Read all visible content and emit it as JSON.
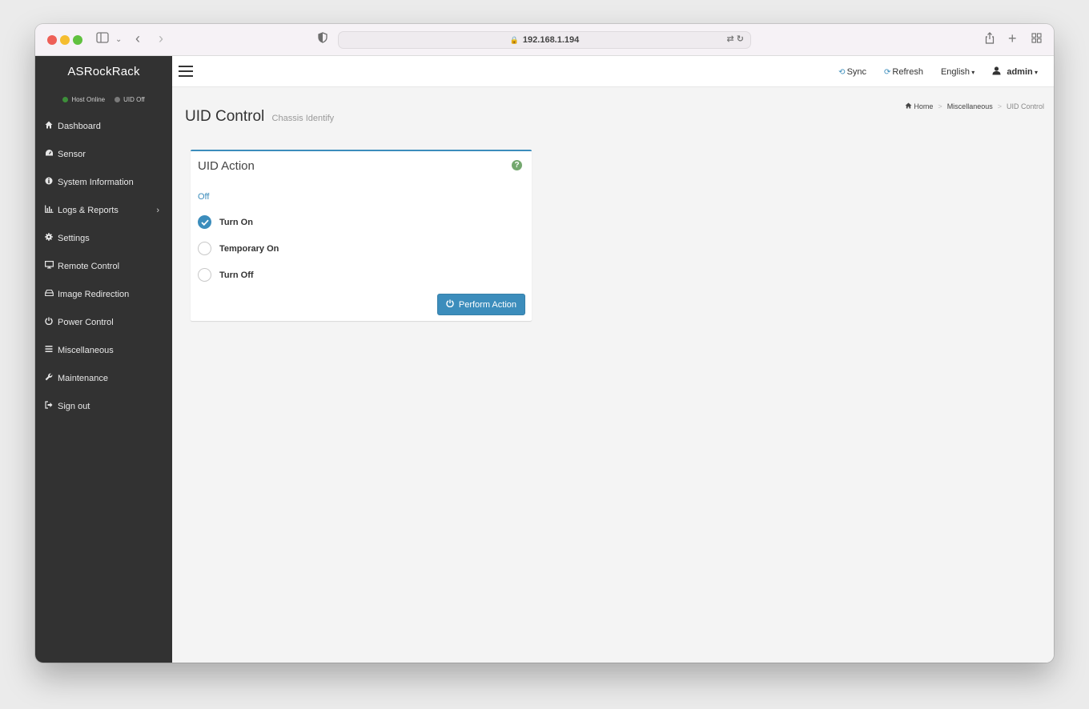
{
  "browser": {
    "url": "192.168.1.194"
  },
  "sidebar": {
    "brand": "ASRockRack",
    "status": [
      {
        "label": "Host Online",
        "color": "#3d8f3a"
      },
      {
        "label": "UID Off",
        "color": "#7a7a7a"
      }
    ],
    "items": [
      {
        "label": "Dashboard",
        "icon": "home-icon"
      },
      {
        "label": "Sensor",
        "icon": "tachometer-icon"
      },
      {
        "label": "System Information",
        "icon": "info-circle-icon"
      },
      {
        "label": "Logs & Reports",
        "icon": "bar-chart-icon",
        "submenu": true
      },
      {
        "label": "Settings",
        "icon": "gear-icon"
      },
      {
        "label": "Remote Control",
        "icon": "desktop-icon"
      },
      {
        "label": "Image Redirection",
        "icon": "hdd-icon"
      },
      {
        "label": "Power Control",
        "icon": "power-icon"
      },
      {
        "label": "Miscellaneous",
        "icon": "list-icon"
      },
      {
        "label": "Maintenance",
        "icon": "wrench-icon"
      },
      {
        "label": "Sign out",
        "icon": "sign-out-icon"
      }
    ]
  },
  "topbar": {
    "sync": "Sync",
    "refresh": "Refresh",
    "language": "English",
    "user": "admin"
  },
  "page": {
    "title": "UID Control",
    "subtitle": "Chassis Identify",
    "breadcrumb": {
      "home": "Home",
      "section": "Miscellaneous",
      "current": "UID Control"
    }
  },
  "uid_box": {
    "title": "UID Action",
    "current_state": "Off",
    "options": [
      {
        "label": "Turn On",
        "checked": true
      },
      {
        "label": "Temporary On",
        "checked": false
      },
      {
        "label": "Turn Off",
        "checked": false
      }
    ],
    "button_label": "Perform Action"
  },
  "colors": {
    "accent": "#3c8dbc",
    "sidebar_bg": "#323232",
    "help_icon": "#74a86f"
  }
}
